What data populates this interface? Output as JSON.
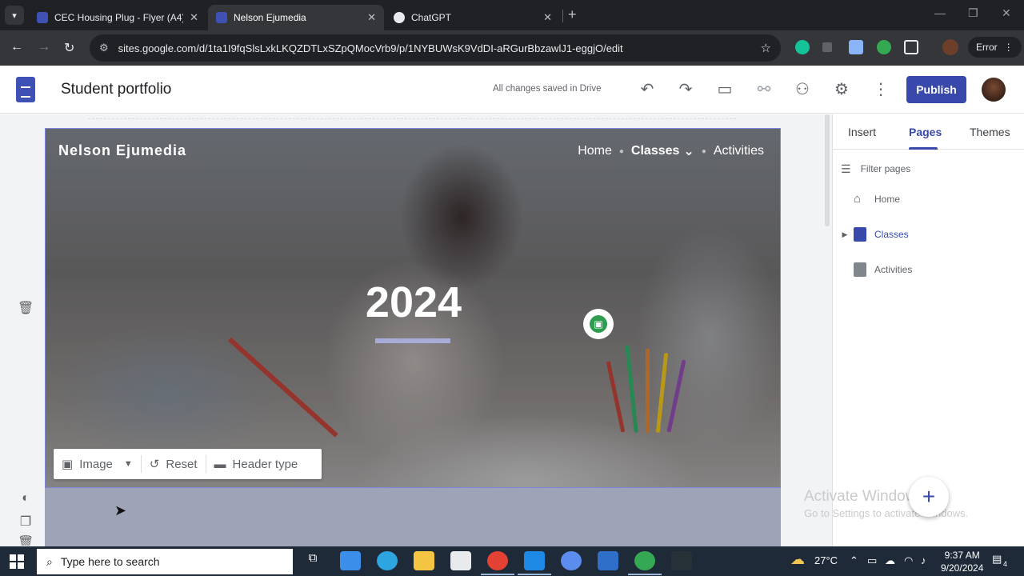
{
  "browser": {
    "tabs": [
      {
        "title": "CEC Housing Plug - Flyer (A4)",
        "active": false,
        "favicon_color": "#3f51b5"
      },
      {
        "title": "Nelson Ejumedia",
        "active": true,
        "favicon_color": "#3f51b5"
      },
      {
        "title": "ChatGPT",
        "active": false,
        "favicon_color": "#e8eaed"
      }
    ],
    "url": "sites.google.com/d/1ta1I9fqSlsLxkLKQZDTLxSZpQMocVrb9/p/1NYBUWsK9VdDI-aRGurBbzawlJ1-eggjO/edit",
    "profile_status": "Error"
  },
  "sites_header": {
    "doc_title": "Student portfolio",
    "save_status": "All changes saved in Drive",
    "publish_label": "Publish",
    "accent": "#3949ab"
  },
  "hero": {
    "site_name": "Nelson Ejumedia",
    "nav": [
      "Home",
      "Classes",
      "Activities"
    ],
    "active_nav": "Classes",
    "year": "2024"
  },
  "header_toolbar": {
    "image_label": "Image",
    "reset_label": "Reset",
    "header_type_label": "Header type"
  },
  "right_panel": {
    "tabs": [
      "Insert",
      "Pages",
      "Themes"
    ],
    "active_tab": "Pages",
    "filter_placeholder": "Filter pages",
    "pages": [
      {
        "label": "Home",
        "icon": "home-icon"
      },
      {
        "label": "Classes",
        "icon": "page-icon",
        "selected": true
      },
      {
        "label": "Activities",
        "icon": "page-icon"
      }
    ]
  },
  "watermark": {
    "line1": "Activate Windows",
    "line2": "Go to Settings to activate Windows."
  },
  "taskbar": {
    "search_placeholder": "Type here to search",
    "temperature": "27°C",
    "time": "9:37 AM",
    "date": "9/20/2024",
    "notifications": "4"
  }
}
